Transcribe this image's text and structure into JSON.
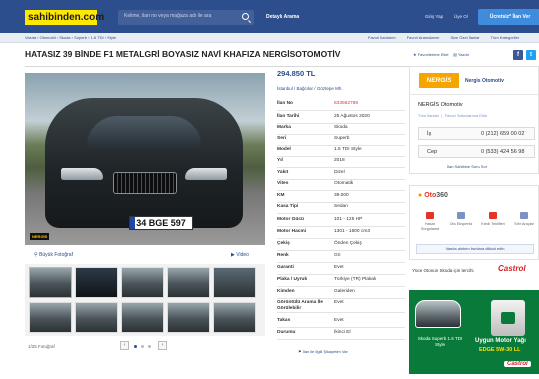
{
  "header": {
    "logo": "sahibinden.com",
    "search_placeholder": "Kelime, ilan no veya mağaza adı ile ara",
    "detailed_search": "Detaylı Arama",
    "login": "Giriş Yap",
    "register": "Üye Ol",
    "post_ad": "Ücretsiz* İlan Ver"
  },
  "breadcrumbs": [
    "Vasıta",
    "Otomobil",
    "Skoda",
    "Superb",
    "1.6 TDI",
    "Style"
  ],
  "top_links": [
    "Favori İlanlarım",
    "Favori Aramalarım",
    "Size Özel İlanlar",
    "Tüm Kategoriler"
  ],
  "listing": {
    "title": "HATASIZ 39 BİNDE F1 METALGRİ BOYASIZ NAVİ KHAFIZA NERGİSOTOMOTİV",
    "add_favorite": "Favorilerime Ekle",
    "print": "Yazdır",
    "price": "294.850 TL",
    "location": [
      "İstanbul",
      "Bağcılar",
      "Göztepe Mh."
    ],
    "details": [
      {
        "label": "İlan No",
        "value": "833562788",
        "highlight": true
      },
      {
        "label": "İlan Tarihi",
        "value": "25 Ağustos 2020"
      },
      {
        "label": "Marka",
        "value": "Skoda"
      },
      {
        "label": "Seri",
        "value": "Superb"
      },
      {
        "label": "Model",
        "value": "1.6 TDI Style"
      },
      {
        "label": "Yıl",
        "value": "2018"
      },
      {
        "label": "Yakıt",
        "value": "Dizel"
      },
      {
        "label": "Vites",
        "value": "Otomatik"
      },
      {
        "label": "KM",
        "value": "39.000"
      },
      {
        "label": "Kasa Tipi",
        "value": "Sedan"
      },
      {
        "label": "Motor Gücü",
        "value": "101 - 125 HP"
      },
      {
        "label": "Motor Hacmi",
        "value": "1301 - 1600 cm3"
      },
      {
        "label": "Çekiş",
        "value": "Önden Çekiş"
      },
      {
        "label": "Renk",
        "value": "Gri"
      },
      {
        "label": "Garanti",
        "value": "Evet"
      },
      {
        "label": "Plaka / Uyruk",
        "value": "Türkiye (TR) Plakalı"
      },
      {
        "label": "Kimden",
        "value": "Galeriden"
      },
      {
        "label": "Görüntülü Arama İle Görülebilir",
        "value": "Evet"
      },
      {
        "label": "Takas",
        "value": "Evet"
      },
      {
        "label": "Durumu",
        "value": "İkinci El"
      }
    ],
    "complaint": "İlan ile İlgili Şikayetim Var"
  },
  "gallery": {
    "plate_text": "34 BGE 597",
    "watermark": "NERGİS",
    "big_photo": "Büyük Fotoğraf",
    "video": "Video",
    "counter": "1/25 Fotoğraf"
  },
  "store": {
    "logo_text": "NERGİS",
    "store_link": "Nergis Otomotiv",
    "name": "NERGİS Otomotiv",
    "links": [
      "Tüm İlanları",
      "Favori Satıcılarıma Ekle"
    ],
    "phones": [
      {
        "label": "İş",
        "number": "0 (212) 659 00 02"
      },
      {
        "label": "Cep",
        "number": "0 (533) 424 56 98"
      }
    ],
    "all_ads": "İlan Sahibine Soru Sor"
  },
  "oto360": {
    "logo_red": "Oto",
    "logo_gray": "360",
    "items": [
      "Hasar Sorgulama",
      "Oto Ekspertiz",
      "Kredi Teklifleri",
      "Sıfır Araçlar"
    ],
    "button": "Vasıta alırken bunlara dikkat edin"
  },
  "ad": {
    "line": "Yüce Otonun Skoda için tercihi",
    "brand": "Castrol",
    "car_caption": "Skoda Superb 1.6 TDI Style",
    "headline": "Uygun Motor Yağı",
    "product": "EDGE 5W-30 LL"
  }
}
